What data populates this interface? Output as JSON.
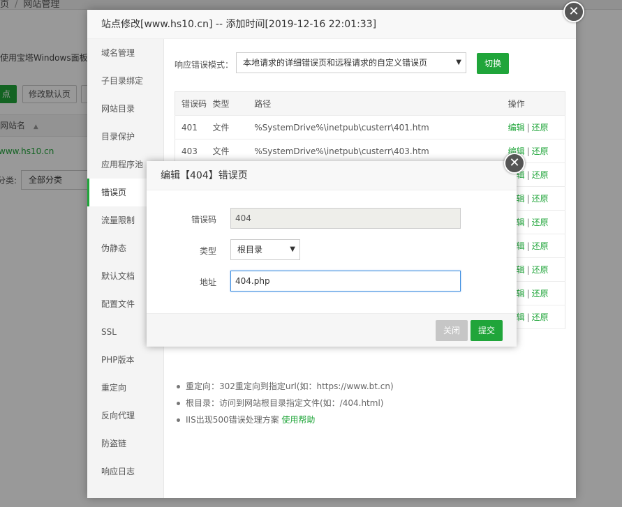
{
  "background": {
    "breadcrumb": [
      "页",
      "网站管理"
    ],
    "notice": "使用宝塔Windows面板创",
    "add_site_btn": "点",
    "modify_default_btn": "修改默认页",
    "table_header_name": "网站名",
    "site_link": "www.hs10.cn",
    "category_label": "分类:",
    "category_value": "全部分类"
  },
  "main_dialog": {
    "title": "站点修改[www.hs10.cn] -- 添加时间[2019-12-16 22:01:33]",
    "close_icon": "✕",
    "side_menu": [
      {
        "label": "域名管理"
      },
      {
        "label": "子目录绑定"
      },
      {
        "label": "网站目录"
      },
      {
        "label": "目录保护"
      },
      {
        "label": "应用程序池"
      },
      {
        "label": "错误页"
      },
      {
        "label": "流量限制"
      },
      {
        "label": "伪静态"
      },
      {
        "label": "默认文档"
      },
      {
        "label": "配置文件"
      },
      {
        "label": "SSL"
      },
      {
        "label": "PHP版本"
      },
      {
        "label": "重定向"
      },
      {
        "label": "反向代理"
      },
      {
        "label": "防盗链"
      },
      {
        "label": "响应日志"
      }
    ],
    "active_menu": "错误页",
    "mode_label": "响应错误模式：",
    "mode_value": "本地请求的详细错误页和远程请求的自定义错误页",
    "switch_btn": "切换",
    "table": {
      "headers": [
        "错误码",
        "类型",
        "路径",
        "操作"
      ],
      "rows": [
        {
          "code": "401",
          "type": "文件",
          "path": "%SystemDrive%\\inetpub\\custerr\\401.htm"
        },
        {
          "code": "403",
          "type": "文件",
          "path": "%SystemDrive%\\inetpub\\custerr\\403.htm"
        },
        {
          "code": "",
          "type": "",
          "path": ""
        },
        {
          "code": "",
          "type": "",
          "path": ""
        },
        {
          "code": "",
          "type": "",
          "path": ""
        },
        {
          "code": "",
          "type": "",
          "path": ""
        },
        {
          "code": "",
          "type": "",
          "path": ""
        },
        {
          "code": "",
          "type": "",
          "path": ""
        },
        {
          "code": "",
          "type": "",
          "path": ""
        }
      ],
      "edit_label": "编辑",
      "restore_label": "还原",
      "separator": "|"
    },
    "tips": [
      {
        "text": "重定向：302重定向到指定url(如：https://www.bt.cn)",
        "link": ""
      },
      {
        "text": "根目录：访问到网站根目录指定文件(如：/404.html)",
        "link": ""
      },
      {
        "text": "IIS出现500错误处理方案 ",
        "link": "使用帮助"
      }
    ]
  },
  "edit_dialog": {
    "title": "编辑【404】错误页",
    "close_icon": "✕",
    "code_label": "错误码",
    "code_value": "404",
    "type_label": "类型",
    "type_value": "根目录",
    "address_label": "地址",
    "address_value": "404.php",
    "close_btn": "关闭",
    "submit_btn": "提交"
  },
  "colors": {
    "accent": "#20a53a",
    "overlay": "#000000"
  }
}
